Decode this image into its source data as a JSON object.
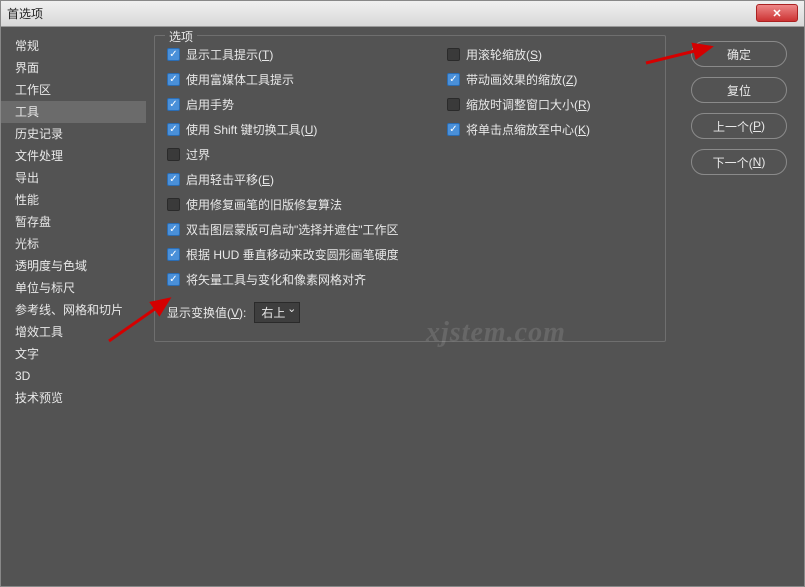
{
  "window": {
    "title": "首选项"
  },
  "sidebar": {
    "items": [
      {
        "label": "常规"
      },
      {
        "label": "界面"
      },
      {
        "label": "工作区"
      },
      {
        "label": "工具"
      },
      {
        "label": "历史记录"
      },
      {
        "label": "文件处理"
      },
      {
        "label": "导出"
      },
      {
        "label": "性能"
      },
      {
        "label": "暂存盘"
      },
      {
        "label": "光标"
      },
      {
        "label": "透明度与色域"
      },
      {
        "label": "单位与标尺"
      },
      {
        "label": "参考线、网格和切片"
      },
      {
        "label": "增效工具"
      },
      {
        "label": "文字"
      },
      {
        "label": "3D"
      },
      {
        "label": "技术预览"
      }
    ],
    "active_index": 3
  },
  "options": {
    "legend": "选项",
    "left": [
      {
        "checked": true,
        "label_pre": "显示工具提示(",
        "key": "T",
        "label_post": ")"
      },
      {
        "checked": true,
        "label_pre": "使用富媒体工具提示",
        "key": "",
        "label_post": ""
      },
      {
        "checked": true,
        "label_pre": "启用手势",
        "key": "",
        "label_post": ""
      },
      {
        "checked": true,
        "label_pre": "使用 Shift 键切换工具(",
        "key": "U",
        "label_post": ")"
      },
      {
        "checked": false,
        "label_pre": "过界",
        "key": "",
        "label_post": ""
      },
      {
        "checked": true,
        "label_pre": "启用轻击平移(",
        "key": "E",
        "label_post": ")"
      },
      {
        "checked": false,
        "label_pre": "使用修复画笔的旧版修复算法",
        "key": "",
        "label_post": ""
      },
      {
        "checked": true,
        "label_pre": "双击图层蒙版可启动\"选择并遮住\"工作区",
        "key": "",
        "label_post": ""
      },
      {
        "checked": true,
        "label_pre": "根据 HUD 垂直移动来改变圆形画笔硬度",
        "key": "",
        "label_post": ""
      },
      {
        "checked": true,
        "label_pre": "将矢量工具与变化和像素网格对齐",
        "key": "",
        "label_post": ""
      }
    ],
    "right": [
      {
        "checked": false,
        "label_pre": "用滚轮缩放(",
        "key": "S",
        "label_post": ")"
      },
      {
        "checked": true,
        "label_pre": "带动画效果的缩放(",
        "key": "Z",
        "label_post": ")"
      },
      {
        "checked": false,
        "label_pre": "缩放时调整窗口大小(",
        "key": "R",
        "label_post": ")"
      },
      {
        "checked": true,
        "label_pre": "将单击点缩放至中心(",
        "key": "K",
        "label_post": ")"
      }
    ],
    "transform_label_pre": "显示变换值(",
    "transform_key": "V",
    "transform_label_post": "):",
    "transform_value": "右上"
  },
  "buttons": {
    "ok": "确定",
    "reset": "复位",
    "prev_pre": "上一个(",
    "prev_key": "P",
    "prev_post": ")",
    "next_pre": "下一个(",
    "next_key": "N",
    "next_post": ")"
  },
  "watermark": "xjstem.com"
}
